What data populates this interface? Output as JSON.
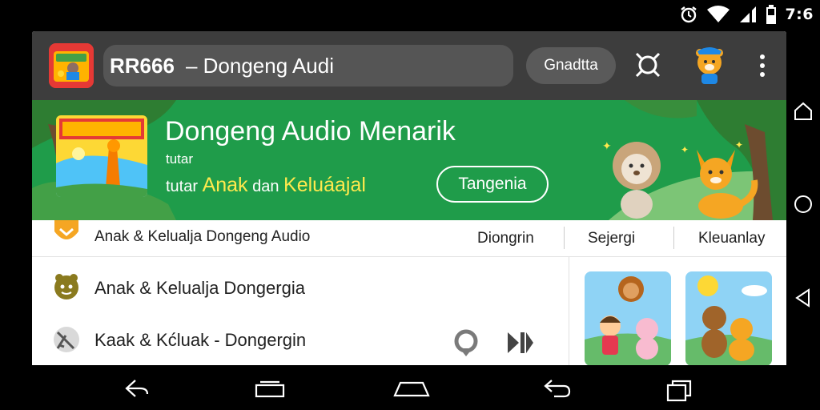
{
  "status_bar": {
    "time": "7:6",
    "icons": [
      "alarm-icon",
      "wifi-icon",
      "signal-icon",
      "battery-icon"
    ]
  },
  "app_bar": {
    "title_code": "RR666",
    "title_text": "–  Dongeng Audi",
    "action_label": "Gnadtta"
  },
  "banner": {
    "title": "Dongeng Audio Menarik",
    "subtitle_1": "tutar",
    "subtitle_2_prefix": "tutar ",
    "subtitle_2_hl1": "Anak",
    "subtitle_2_mid": " dan ",
    "subtitle_2_hl2": "Keluáajal",
    "button_label": "Tangenia",
    "colors": {
      "background": "#1f9c4a",
      "highlight": "#ffe94d"
    }
  },
  "tab_row": {
    "label": "Anak & Kelualja Dongeng Audio",
    "tabs": [
      "Diongrin",
      "Sejergi",
      "Kleuanlay"
    ]
  },
  "list": {
    "items": [
      {
        "label": "Anak & Kelualja Dongergia",
        "icon": "face-icon"
      },
      {
        "label": "Kaak & Kćluak - Dongergin",
        "icon": "pencil-icon"
      }
    ]
  },
  "thumbnails": [
    {
      "icon": "kids-with-bear-picture"
    },
    {
      "icon": "bears-with-sun-picture"
    }
  ],
  "nav": {
    "side": [
      "home-icon",
      "circle-home-icon",
      "back-triangle-icon"
    ],
    "bottom": [
      "back-icon",
      "home-icon",
      "home-pill-icon",
      "return-icon",
      "recents-icon"
    ]
  }
}
